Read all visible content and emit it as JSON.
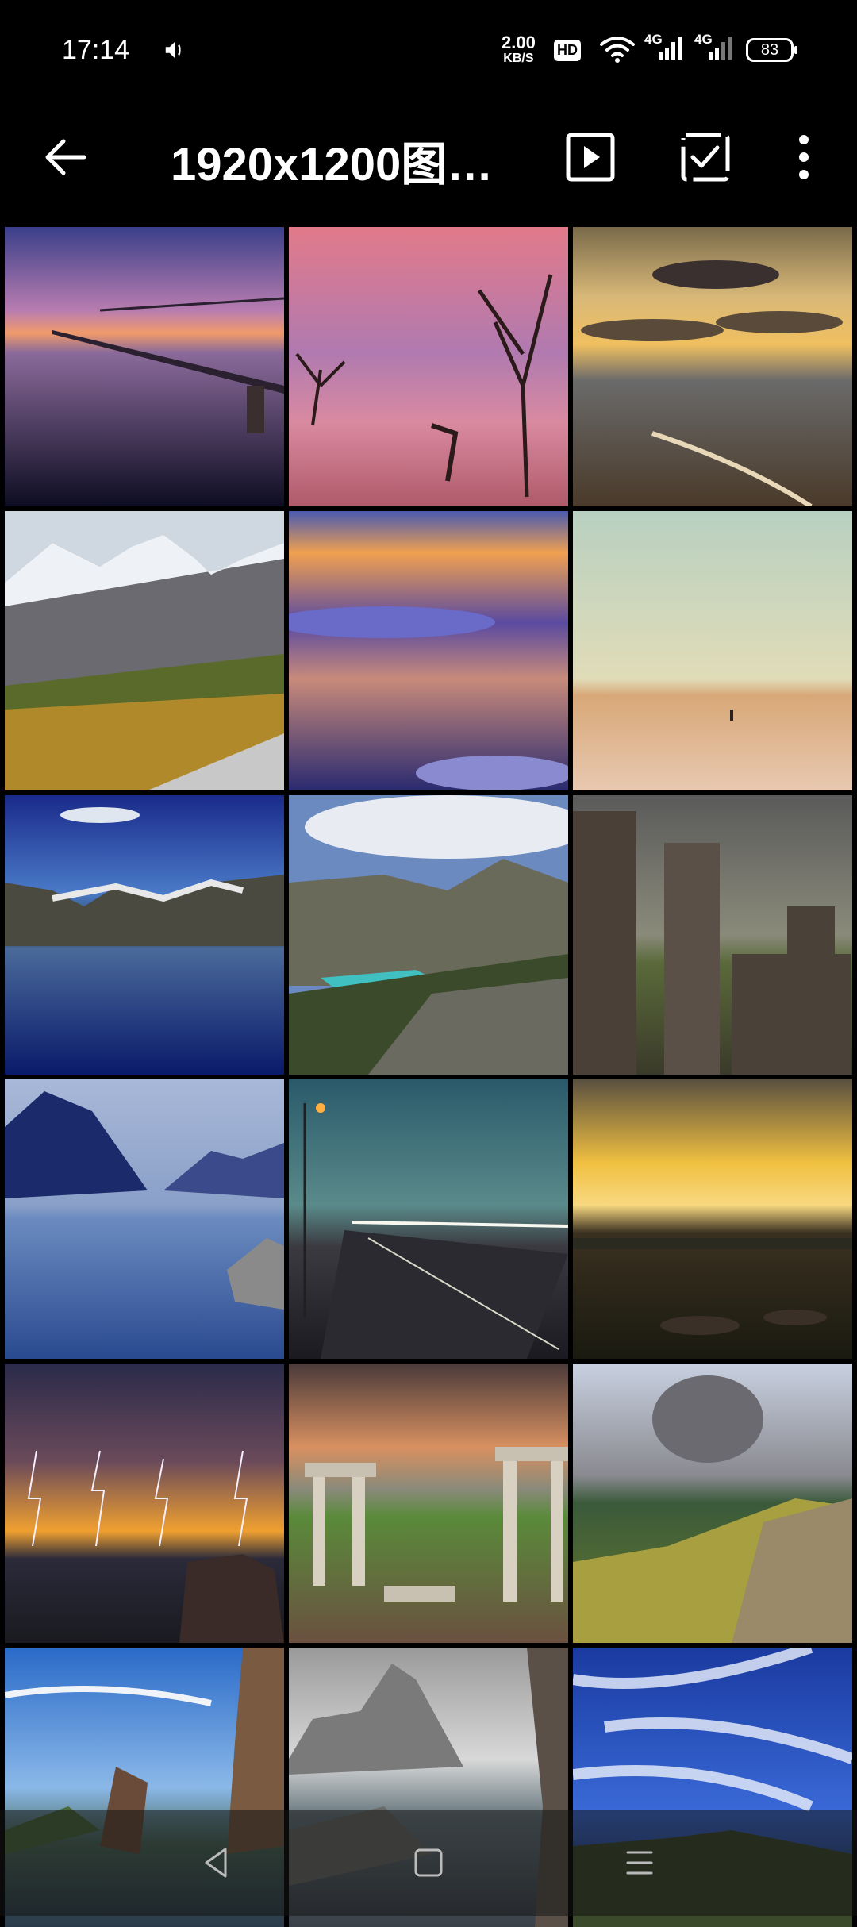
{
  "status_bar": {
    "time": "17:14",
    "net_speed_value": "2.00",
    "net_speed_unit": "KB/S",
    "hd_label": "HD",
    "sim1_label": "4G",
    "sim2_label": "4G",
    "battery_level": "83"
  },
  "app_bar": {
    "title": "1920x1200图…"
  },
  "gallery": {
    "items": [
      {
        "name": "pier-sunset"
      },
      {
        "name": "pink-lake-trees"
      },
      {
        "name": "beach-sunset-clouds"
      },
      {
        "name": "mountain-valley"
      },
      {
        "name": "sky-above-clouds"
      },
      {
        "name": "beach-person-walking"
      },
      {
        "name": "lake-mountain-reflection"
      },
      {
        "name": "turquoise-lake-valley"
      },
      {
        "name": "castle-ruins-storm"
      },
      {
        "name": "blue-lake-mountains"
      },
      {
        "name": "foggy-road-night"
      },
      {
        "name": "harbor-sunset-boats"
      },
      {
        "name": "lightning-storm"
      },
      {
        "name": "ancient-ruins-columns"
      },
      {
        "name": "green-hills-clouds"
      },
      {
        "name": "coastal-rocks-blue-sky"
      },
      {
        "name": "sea-rock-formation"
      },
      {
        "name": "starry-sky-clouds"
      }
    ]
  },
  "nav_bar": {
    "back_icon": "triangle-back-icon",
    "home_icon": "square-home-icon",
    "menu_icon": "lines-menu-icon"
  }
}
